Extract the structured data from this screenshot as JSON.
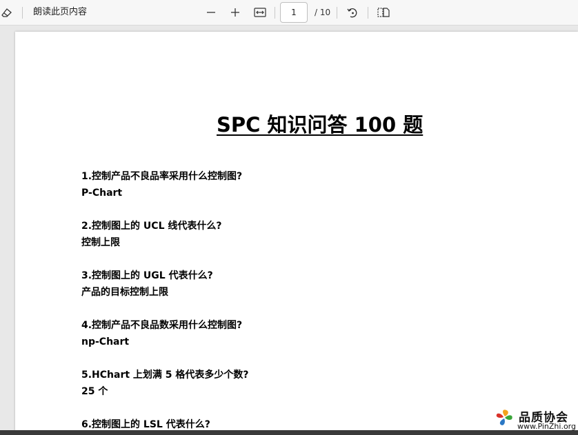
{
  "toolbar": {
    "read_aloud": "朗读此页内容",
    "current_page": "1",
    "total_pages": "/ 10",
    "icons": [
      "eraser-icon",
      "zoom-out-icon",
      "zoom-in-icon",
      "fit-width-icon",
      "rotate-icon",
      "page-view-icon"
    ]
  },
  "document": {
    "title": "SPC 知识问答 100 题",
    "items": [
      {
        "q": "1.控制产品不良品率采用什么控制图?",
        "a": "P-Chart"
      },
      {
        "q": "2.控制图上的 UCL 线代表什么?",
        "a": "控制上限"
      },
      {
        "q": "3.控制图上的 UGL 代表什么?",
        "a": "产品的目标控制上限"
      },
      {
        "q": "4.控制产品不良品数采用什么控制图?",
        "a": "np-Chart"
      },
      {
        "q": "5.HChart 上划满 5 格代表多少个数?",
        "a": "25 个"
      },
      {
        "q": "6.控制图上的 LSL 代表什么?",
        "a": ""
      }
    ]
  },
  "watermark": {
    "name": "品质协会",
    "url": "www.PinZhi.org"
  },
  "colors": {
    "toolbar_bg": "#f7f7f7",
    "viewer_bg": "#e8e8e8",
    "page_bg": "#ffffff",
    "text": "#000000"
  }
}
